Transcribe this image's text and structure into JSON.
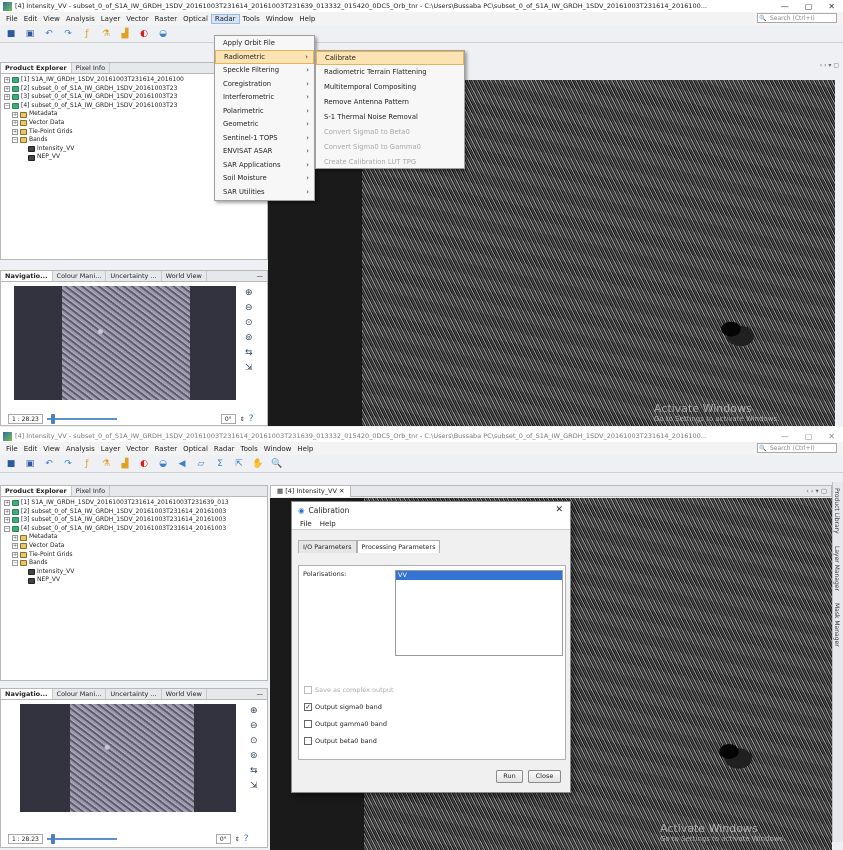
{
  "shot1": {
    "title": "[4] Intensity_VV - subset_0_of_S1A_IW_GRDH_1SDV_20161003T231614_20161003T231639_013332_015420_0DC5_Orb_tnr - C:\\Users\\Bussaba PC\\subset_0_of_S1A_IW_GRDH_1SDV_20161003T231614_2016100...",
    "window_controls": [
      "—",
      "▢",
      "✕"
    ],
    "menus": [
      "File",
      "Edit",
      "View",
      "Analysis",
      "Layer",
      "Vector",
      "Raster",
      "Optical",
      "Radar",
      "Tools",
      "Window",
      "Help"
    ],
    "search_placeholder": "Search (Ctrl+I)",
    "panel_tabs": [
      "Product Explorer",
      "Pixel Info"
    ],
    "tree": [
      "[1] S1A_IW_GRDH_1SDV_20161003T231614_2016100",
      "[2] subset_0_of_S1A_IW_GRDH_1SDV_20161003T23",
      "[3] subset_0_of_S1A_IW_GRDH_1SDV_20161003T23",
      "[4] subset_0_of_S1A_IW_GRDH_1SDV_20161003T23",
      "Metadata",
      "Vector Data",
      "Tie-Point Grids",
      "Bands",
      "Intensity_VV",
      "NEP_VV"
    ],
    "nav_tabs": [
      "Navigatio...",
      "Colour Mani...",
      "Uncertainty ...",
      "World View"
    ],
    "scale": "1 : 28.23",
    "angle": "0°",
    "radar_menu": [
      "Apply Orbit File",
      "Radiometric",
      "Speckle Filtering",
      "Coregistration",
      "Interferometric",
      "Polarimetric",
      "Geometric",
      "Sentinel-1 TOPS",
      "ENVISAT ASAR",
      "SAR Applications",
      "Soil Moisture",
      "SAR Utilities"
    ],
    "radiometric_menu": [
      "Calibrate",
      "Radiometric Terrain Flattening",
      "Multitemporal Compositing",
      "Remove Antenna Pattern",
      "S-1 Thermal Noise Removal",
      "Convert Sigma0 to Beta0",
      "Convert Sigma0 to Gamma0",
      "Create Calibration LUT TPG"
    ],
    "watermark": "Activate Windows",
    "watermark_sub": "Go to Settings to activate Windows."
  },
  "shot2": {
    "title": "[4] Intensity_VV - subset_0_of_S1A_IW_GRDH_1SDV_20161003T231614_20161003T231639_013332_015420_0DC5_Orb_tnr - C:\\Users\\Bussaba PC\\subset_0_of_S1A_IW_GRDH_1SDV_20161003T231614_2016100...",
    "window_controls": [
      "—",
      "▢",
      "✕"
    ],
    "menus": [
      "File",
      "Edit",
      "View",
      "Analysis",
      "Layer",
      "Vector",
      "Raster",
      "Optical",
      "Radar",
      "Tools",
      "Window",
      "Help"
    ],
    "search_placeholder": "Search (Ctrl+I)",
    "panel_tabs": [
      "Product Explorer",
      "Pixel Info"
    ],
    "tree": [
      "[1] S1A_IW_GRDH_1SDV_20161003T231614_20161003T231639_013",
      "[2] subset_0_of_S1A_IW_GRDH_1SDV_20161003T231614_20161003",
      "[3] subset_0_of_S1A_IW_GRDH_1SDV_20161003T231614_20161003",
      "[4] subset_0_of_S1A_IW_GRDH_1SDV_20161003T231614_20161003",
      "Metadata",
      "Vector Data",
      "Tie-Point Grids",
      "Bands",
      "Intensity_VV",
      "NEP_VV"
    ],
    "nav_tabs": [
      "Navigatio...",
      "Colour Mani...",
      "Uncertainty ...",
      "World View"
    ],
    "image_tab": "[4] Intensity_VV",
    "right_tabs": [
      "Product Library",
      "Layer Manager",
      "Mask Manager"
    ],
    "scale": "1 : 28.23",
    "angle": "0°",
    "dialog": {
      "title": "Calibration",
      "menu": [
        "File",
        "Help"
      ],
      "tabs": [
        "I/O Parameters",
        "Processing Parameters"
      ],
      "polarisations_label": "Polarisations:",
      "polarisations": [
        "VV"
      ],
      "checkboxes": [
        {
          "label": "Save as complex output",
          "checked": false,
          "disabled": true
        },
        {
          "label": "Output sigma0 band",
          "checked": true,
          "disabled": false
        },
        {
          "label": "Output gamma0 band",
          "checked": false,
          "disabled": false
        },
        {
          "label": "Output beta0 band",
          "checked": false,
          "disabled": false
        }
      ],
      "run": "Run",
      "close": "Close"
    },
    "watermark": "Activate Windows",
    "watermark_sub": "Go to Settings to activate Windows."
  }
}
